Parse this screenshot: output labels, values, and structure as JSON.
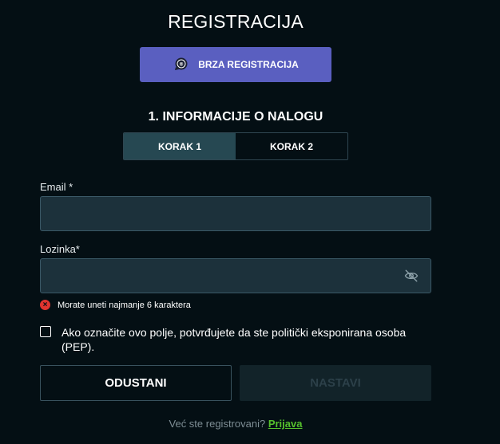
{
  "header": {
    "title": "REGISTRACIJA"
  },
  "quick_registration": {
    "label": "BRZA REGISTRACIJA",
    "icon": "quick-register-badge-icon"
  },
  "section": {
    "title": "1. INFORMACIJE O NALOGU"
  },
  "steps": [
    {
      "label": "KORAK 1",
      "active": true
    },
    {
      "label": "KORAK 2",
      "active": false
    }
  ],
  "form": {
    "email": {
      "label": "Email *",
      "value": "",
      "placeholder": ""
    },
    "password": {
      "label": "Lozinka*",
      "value": "",
      "placeholder": "",
      "icon": "eye-off-icon"
    },
    "error": "Morate uneti najmanje 6 karaktera",
    "pep": {
      "checked": false,
      "text": "Ako označite ovo polje, potvrđujete da ste politički eksponirana osoba (PEP)."
    }
  },
  "buttons": {
    "cancel": "ODUSTANI",
    "next": "NASTAVI"
  },
  "footer": {
    "text": "Već ste registrovani?",
    "link": "Prijava"
  },
  "colors": {
    "background": "#040f14",
    "quick_button": "#5a5fc0",
    "error": "#e0342f",
    "link": "#55c02c"
  }
}
